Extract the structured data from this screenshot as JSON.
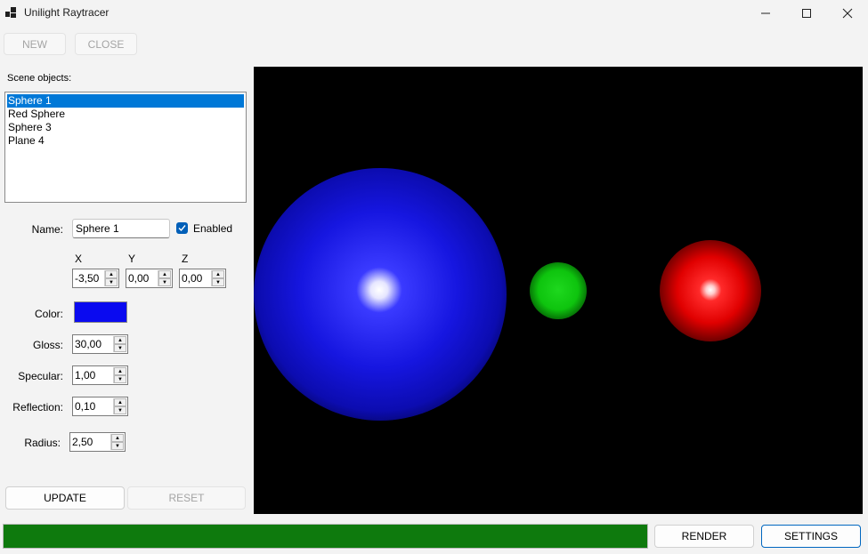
{
  "window": {
    "title": "Unilight Raytracer"
  },
  "toolbar": {
    "new_label": "NEW",
    "close_label": "CLOSE"
  },
  "scene": {
    "label": "Scene objects:",
    "items": [
      "Sphere 1",
      "Red Sphere",
      "Sphere 3",
      "Plane 4"
    ],
    "selected_index": 0
  },
  "props": {
    "name_label": "Name:",
    "name_value": "Sphere 1",
    "enabled_label": "Enabled",
    "enabled": true,
    "x_label": "X",
    "y_label": "Y",
    "z_label": "Z",
    "x_value": "-3,50",
    "y_value": "0,00",
    "z_value": "0,00",
    "color_label": "Color:",
    "color_value": "#0a0af0",
    "gloss_label": "Gloss:",
    "gloss_value": "30,00",
    "specular_label": "Specular:",
    "specular_value": "1,00",
    "reflection_label": "Reflection:",
    "reflection_value": "0,10",
    "radius_label": "Radius:",
    "radius_value": "2,50"
  },
  "actions": {
    "update_label": "UPDATE",
    "reset_label": "RESET"
  },
  "bottom": {
    "render_label": "RENDER",
    "settings_label": "SETTINGS",
    "progress_fraction": 1.0
  },
  "colors": {
    "selection": "#0078d7",
    "progress": "#0e7a0d",
    "accent": "#005fb8"
  }
}
